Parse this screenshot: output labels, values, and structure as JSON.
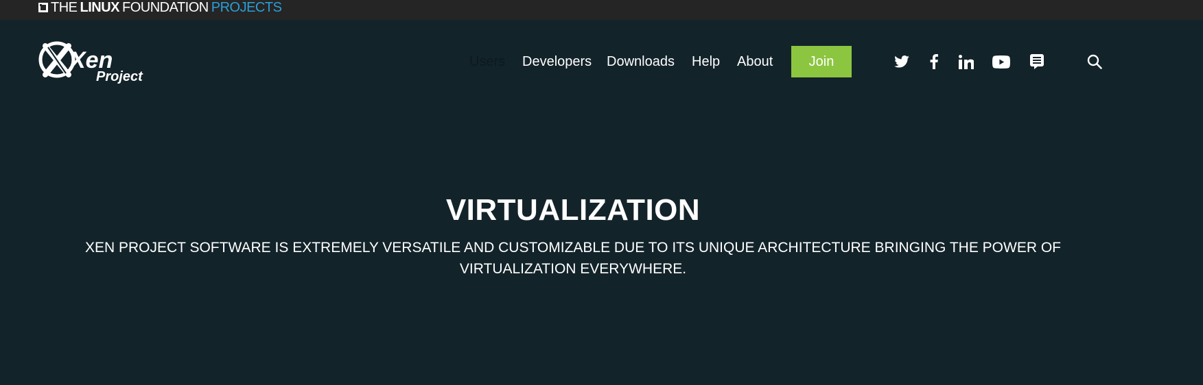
{
  "top_bar": {
    "brand_the": "THE",
    "brand_linux": "LINUX",
    "brand_foundation": "FOUNDATION",
    "brand_projects": "PROJECTS",
    "mark_icon": "linux-foundation-square-icon"
  },
  "header": {
    "logo_main": "Xen",
    "logo_sub": "Project",
    "nav": [
      {
        "label": "Users"
      },
      {
        "label": "Developers"
      },
      {
        "label": "Downloads"
      },
      {
        "label": "Help"
      },
      {
        "label": "About"
      }
    ],
    "join_label": "Join",
    "social_icons": [
      "twitter-icon",
      "facebook-icon",
      "linkedin-icon",
      "youtube-icon",
      "chat-icon"
    ],
    "search_icon": "search-icon"
  },
  "hero": {
    "title": "VIRTUALIZATION",
    "subtitle_line1": "XEN PROJECT SOFTWARE IS EXTREMELY VERSATILE AND CUSTOMIZABLE DUE TO ITS UNIQUE ARCHITECTURE BRINGING THE POWER OF",
    "subtitle_line2": "VIRTUALIZATION EVERYWHERE."
  },
  "colors": {
    "background": "#13232a",
    "top_bar": "#252525",
    "accent_green": "#8cc640",
    "projects_blue": "#2a9fd8",
    "text": "#ffffff"
  }
}
